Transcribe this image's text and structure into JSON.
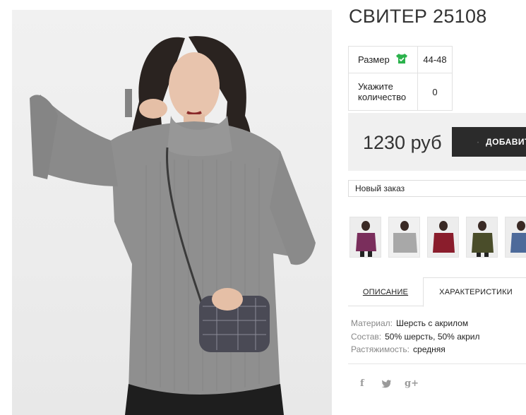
{
  "product": {
    "title": "СВИТЕР 25108"
  },
  "options": {
    "size_label": "Размер",
    "size_value": "44-48",
    "qty_label": "Укажите количество",
    "qty_value": "0"
  },
  "price": {
    "amount": "1230 руб",
    "buy_label": "ДОБАВИТЬ"
  },
  "order_select": {
    "selected": "Новый заказ"
  },
  "thumbnails": [
    {
      "color_name": "purple",
      "color": "#7a2e5c"
    },
    {
      "color_name": "grey",
      "color": "#a8a8a8"
    },
    {
      "color_name": "burgundy",
      "color": "#8a1d2c"
    },
    {
      "color_name": "olive",
      "color": "#4a4d2a"
    },
    {
      "color_name": "blue",
      "color": "#4d6a9a"
    }
  ],
  "tabs": {
    "description": "ОПИСАНИЕ",
    "characteristics": "ХАРАКТЕРИСТИКИ"
  },
  "specs": [
    {
      "key": "Материал:",
      "value": "Шерсть с акрилом"
    },
    {
      "key": "Состав:",
      "value": "50% шерсть, 50% акрил"
    },
    {
      "key": "Растяжимость:",
      "value": "средняя"
    }
  ],
  "social": {
    "facebook": "f",
    "twitter": "twitter-icon",
    "googleplus": "g+"
  },
  "colors": {
    "accent_green": "#2bb24c",
    "button_dark": "#2b2b2b",
    "price_bg": "#f0f0f0",
    "sweater": "#8f8f8f"
  }
}
